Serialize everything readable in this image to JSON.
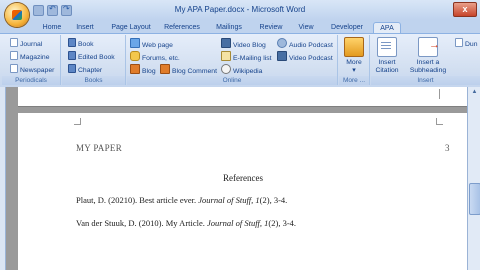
{
  "window": {
    "title": "My APA Paper.docx - Microsoft Word",
    "close_label": "x"
  },
  "tabs": [
    "Home",
    "Insert",
    "Page Layout",
    "References",
    "Mailings",
    "Review",
    "View",
    "Developer",
    "APA"
  ],
  "active_tab": "APA",
  "ribbon": {
    "groups": {
      "periodicals": {
        "label": "Periodicals",
        "items": [
          "Journal",
          "Magazine",
          "Newspaper"
        ]
      },
      "books": {
        "label": "Books",
        "items": [
          "Book",
          "Edited Book",
          "Chapter"
        ]
      },
      "online": {
        "label": "Online",
        "items": [
          "Web page",
          "Forums, etc.",
          "Blog",
          "Blog Comment",
          "Video Blog",
          "E-Mailing list",
          "Wikipedia",
          "Audio Podcast",
          "Video Podcast"
        ]
      },
      "more": {
        "label": "More ...",
        "button": "More"
      },
      "insert": {
        "label": "Insert",
        "citation": "Insert Citation",
        "subheading": "Insert a Subheading",
        "cut": "Dun"
      }
    }
  },
  "document": {
    "running_head": "MY PAPER",
    "page_number": "3",
    "references_title": "References",
    "references": [
      {
        "prefix": "Plaut, D. (20210). Best article ever. ",
        "journal": "Journal of Stuff,",
        "volume": " 1",
        "suffix": "(2), 3-4."
      },
      {
        "prefix": "Van der Stuuk, D. (2010). My Article. ",
        "journal": "Journal of Stuff,",
        "volume": " 1",
        "suffix": "(2), 3-4."
      }
    ]
  },
  "colors": {
    "ribbon_text": "#15428b",
    "tab_bar": "#bfd3ee",
    "workspace": "#9a9a9a"
  }
}
